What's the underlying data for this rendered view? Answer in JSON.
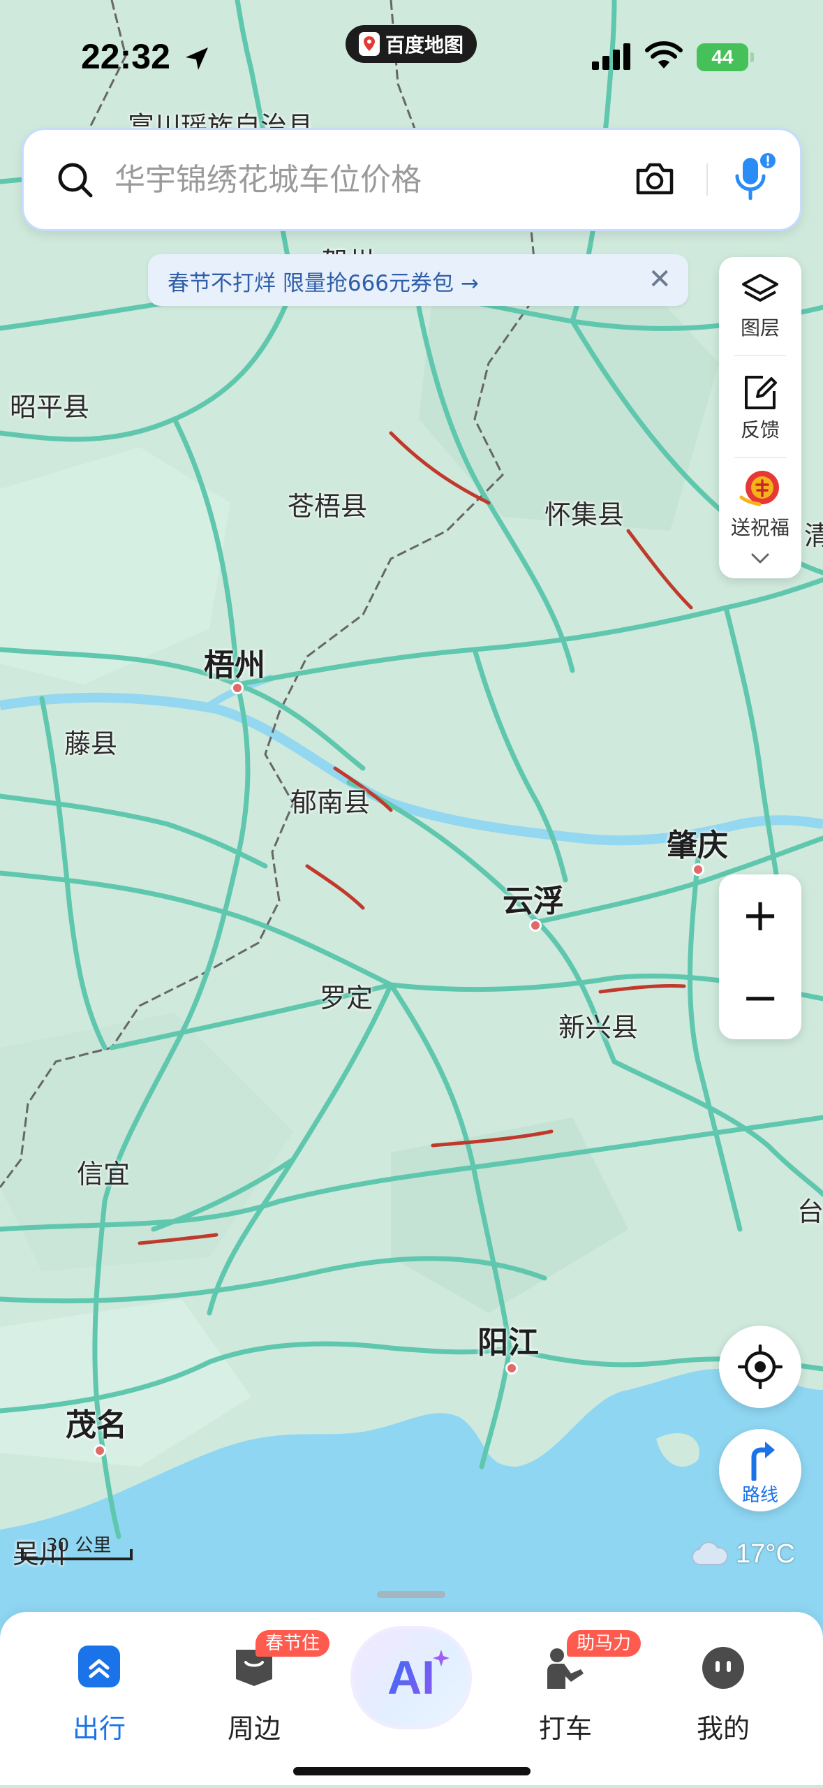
{
  "status_bar": {
    "time": "22:32",
    "app_badge": "百度地图",
    "battery": "44"
  },
  "search": {
    "placeholder": "华宇锦绣花城车位价格"
  },
  "promo": {
    "text": "春节不打烊 限量抢666元券包 →",
    "close": "✕"
  },
  "tools": [
    {
      "label": "图层",
      "icon": "layers-icon"
    },
    {
      "label": "反馈",
      "icon": "feedback-icon"
    },
    {
      "label": "送祝福",
      "icon": "blessing-icon"
    }
  ],
  "zoom": {
    "in": "+",
    "out": "−"
  },
  "route_label": "路线",
  "scale_label": "30 公里",
  "weather": "17°C",
  "map": {
    "colors": {
      "land": "#cfe9dc",
      "road": "#5fc7ad",
      "traffic": "#c0392b",
      "water": "#8fd6f2",
      "border": "#666666"
    },
    "labels": [
      {
        "text": "富川瑶族自治县",
        "kind": "minor"
      },
      {
        "text": "贺州",
        "kind": "minor"
      },
      {
        "text": "昭平县",
        "kind": "minor"
      },
      {
        "text": "苍梧县",
        "kind": "minor"
      },
      {
        "text": "怀集县",
        "kind": "minor"
      },
      {
        "text": "梧州",
        "kind": "major"
      },
      {
        "text": "藤县",
        "kind": "minor"
      },
      {
        "text": "郁南县",
        "kind": "minor"
      },
      {
        "text": "肇庆",
        "kind": "major"
      },
      {
        "text": "云浮",
        "kind": "major"
      },
      {
        "text": "罗定",
        "kind": "minor"
      },
      {
        "text": "新兴县",
        "kind": "minor"
      },
      {
        "text": "信宜",
        "kind": "minor"
      },
      {
        "text": "阳江",
        "kind": "major"
      },
      {
        "text": "茂名",
        "kind": "major"
      },
      {
        "text": "吴川",
        "kind": "minor"
      },
      {
        "text": "台",
        "kind": "minor"
      },
      {
        "text": "清",
        "kind": "minor"
      }
    ]
  },
  "tabbar": {
    "tabs": [
      {
        "label": "出行",
        "active": true
      },
      {
        "label": "周边",
        "badge": "春节住"
      },
      {
        "label": "AI"
      },
      {
        "label": "打车",
        "badge": "助马力"
      },
      {
        "label": "我的"
      }
    ]
  }
}
